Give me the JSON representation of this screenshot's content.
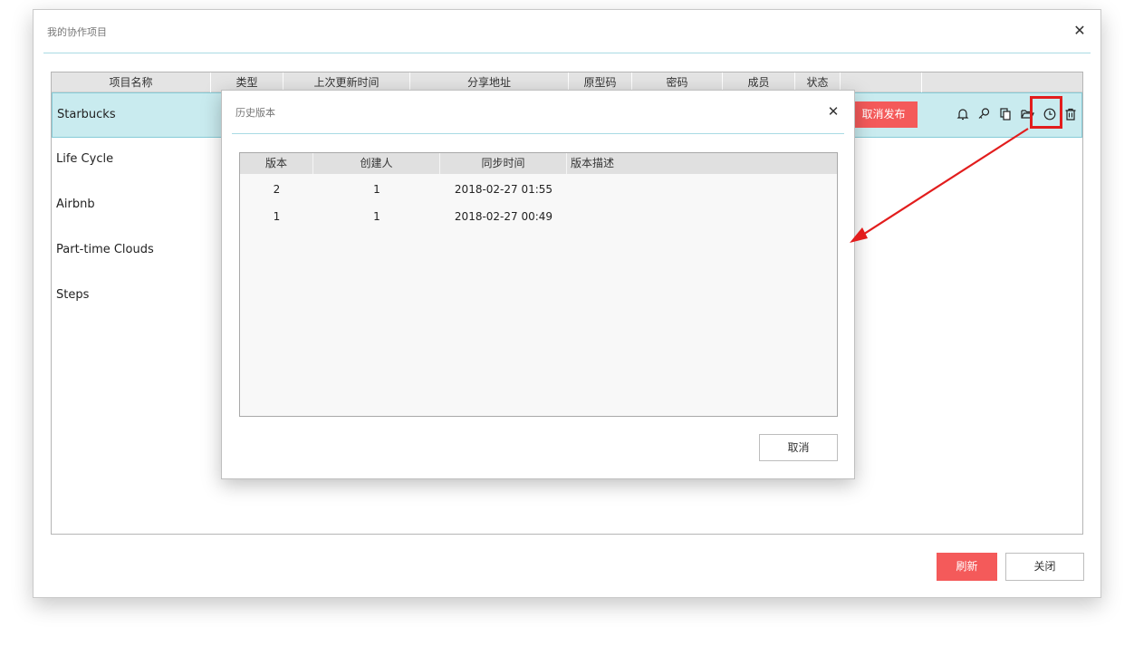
{
  "main_window": {
    "title": "我的协作项目",
    "close_symbol": "✕"
  },
  "project_table": {
    "columns": [
      "项目名称",
      "类型",
      "上次更新时间",
      "分享地址",
      "原型码",
      "密码",
      "成员",
      "状态",
      ""
    ],
    "rows": [
      {
        "name": "Starbucks",
        "selected": true
      },
      {
        "name": "Life Cycle",
        "selected": false
      },
      {
        "name": "Airbnb",
        "selected": false
      },
      {
        "name": "Part-time Clouds",
        "selected": false
      },
      {
        "name": "Steps",
        "selected": false
      }
    ],
    "unpublish_label": "取消发布",
    "row_icons": [
      "bell-icon",
      "key-icon",
      "copy-icon",
      "folder-open-icon",
      "history-clock-icon",
      "trash-icon"
    ]
  },
  "footer": {
    "refresh_label": "刷新",
    "close_label": "关闭"
  },
  "history_modal": {
    "title": "历史版本",
    "close_symbol": "✕",
    "columns": [
      "版本",
      "创建人",
      "同步时间",
      "版本描述"
    ],
    "rows": [
      {
        "version": "2",
        "creator": "1",
        "sync_time": "2018-02-27 01:55",
        "description": ""
      },
      {
        "version": "1",
        "creator": "1",
        "sync_time": "2018-02-27 00:49",
        "description": ""
      }
    ],
    "cancel_label": "取消"
  },
  "colors": {
    "accent_red": "#f45a5a",
    "selected_row": "#c9ebef",
    "divider": "#a9dbe4",
    "annotation": "#e21d1d"
  }
}
